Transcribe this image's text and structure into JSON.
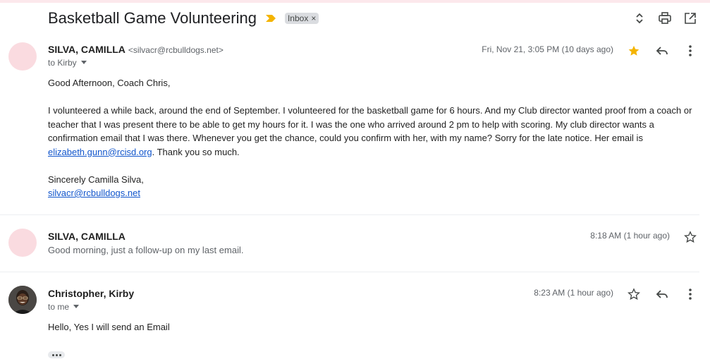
{
  "thread": {
    "subject": "Basketball Game Volunteering",
    "label": "Inbox",
    "label_remove": "×"
  },
  "header_icons": [
    "expand-collapse-icon",
    "print-icon",
    "open-in-new-window-icon"
  ],
  "messages": [
    {
      "sender": "SILVA, CAMILLA",
      "email": "<silvacr@rcbulldogs.net>",
      "to": "to Kirby",
      "date": "Fri, Nov 21, 3:05 PM (10 days ago)",
      "starred": true,
      "body": {
        "greeting": "Good Afternoon, Coach Chris,",
        "paragraph": "I volunteered a while back, around the end of September. I volunteered for the basketball game for 6 hours. And my Club director wanted proof from a coach or teacher that I was present there to be able to get my hours for it. I was the one who arrived around 2 pm to help with scoring. My club director wants a confirmation email that I was there. Whenever you get the chance, could you confirm with her, with my name? Sorry for the late notice. Her email is ",
        "link": "elizabeth.gunn@rcisd.org",
        "paragraph_end": ". Thank you so much.",
        "closing": "Sincerely Camilla Silva,",
        "signature_link": "silvacr@rcbulldogs.net"
      }
    },
    {
      "sender": "SILVA, CAMILLA",
      "date": "8:18 AM (1 hour ago)",
      "snippet": "Good morning, just a follow-up on my last email.",
      "starred": false
    },
    {
      "sender": "Christopher, Kirby",
      "to": "to me",
      "date": "8:23 AM (1 hour ago)",
      "starred": false,
      "body": "Hello, Yes I will send an Email"
    }
  ],
  "colors": {
    "accent_link": "#1155cc",
    "star_active": "#f4b400",
    "importance_marker": "#f4b400",
    "avatar_pink": "#fadbe0"
  }
}
